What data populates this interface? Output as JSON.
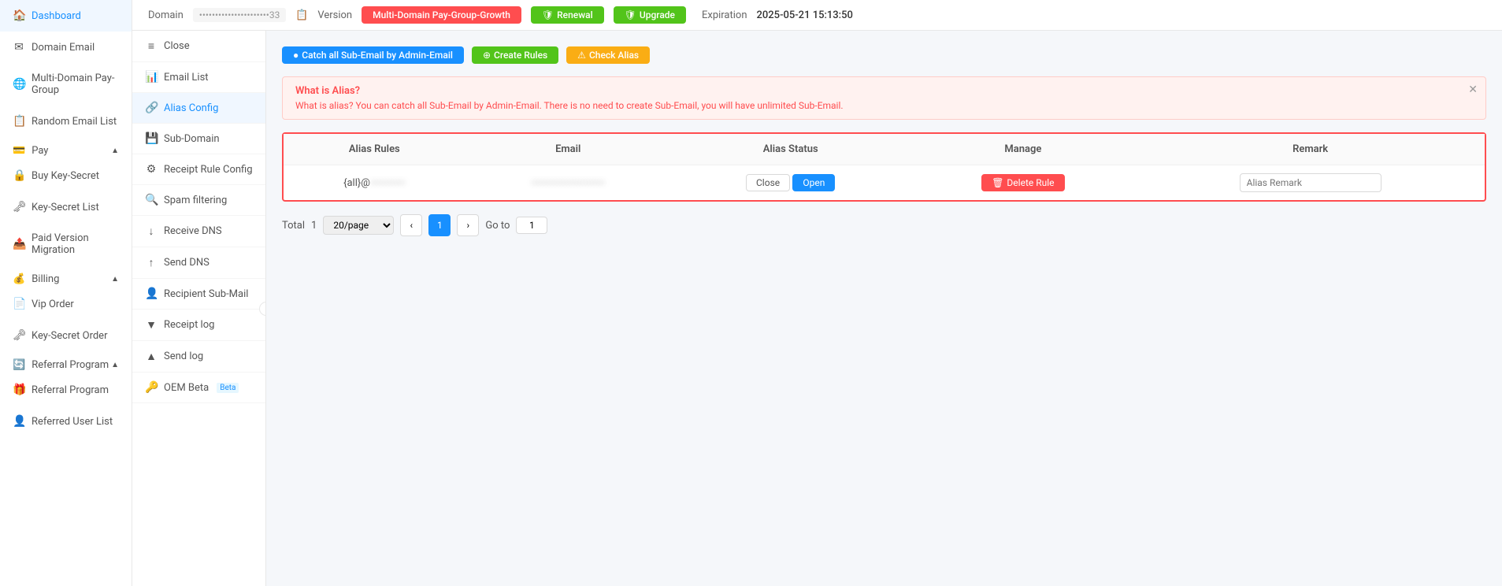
{
  "sidebar": {
    "items": [
      {
        "id": "dashboard",
        "label": "Dashboard",
        "icon": "🏠"
      },
      {
        "id": "domain-email",
        "label": "Domain Email",
        "icon": "✉"
      },
      {
        "id": "multi-domain",
        "label": "Multi-Domain Pay-Group",
        "icon": "🌐"
      },
      {
        "id": "random-email",
        "label": "Random Email List",
        "icon": "📋"
      },
      {
        "id": "pay",
        "label": "Pay",
        "icon": "💳",
        "expandable": true
      },
      {
        "id": "buy-key-secret",
        "label": "Buy Key-Secret",
        "icon": "🔒"
      },
      {
        "id": "key-secret-list",
        "label": "Key-Secret List",
        "icon": "🗝"
      },
      {
        "id": "paid-version",
        "label": "Paid Version Migration",
        "icon": "📤"
      },
      {
        "id": "billing",
        "label": "Billing",
        "icon": "💰",
        "expandable": true
      },
      {
        "id": "vip-order",
        "label": "Vip Order",
        "icon": "📄"
      },
      {
        "id": "key-secret-order",
        "label": "Key-Secret Order",
        "icon": "🗝"
      },
      {
        "id": "referral-program",
        "label": "Referral Program",
        "icon": "🔄",
        "expandable": true
      },
      {
        "id": "referral-program2",
        "label": "Referral Program",
        "icon": "🎁"
      },
      {
        "id": "referred-user",
        "label": "Referred User List",
        "icon": "👤"
      }
    ]
  },
  "header": {
    "domain_label": "Domain",
    "domain_value": "••••••••••••••••••••••33",
    "version_label": "Version",
    "version_value": "Multi-Domain Pay-Group-Growth",
    "renewal_label": "Renewal",
    "upgrade_label": "Upgrade",
    "expiration_label": "Expiration",
    "expiration_value": "2025-05-21 15:13:50"
  },
  "left_nav": {
    "close_label": "Close",
    "items": [
      {
        "id": "email-list",
        "label": "Email List",
        "icon": "📊"
      },
      {
        "id": "alias-config",
        "label": "Alias Config",
        "icon": "🔗",
        "active": true
      },
      {
        "id": "sub-domain",
        "label": "Sub-Domain",
        "icon": "💾"
      },
      {
        "id": "receipt-rule",
        "label": "Receipt Rule Config",
        "icon": "⚙"
      },
      {
        "id": "spam-filtering",
        "label": "Spam filtering",
        "icon": "🔍"
      },
      {
        "id": "receive-dns",
        "label": "Receive DNS",
        "icon": "↓"
      },
      {
        "id": "send-dns",
        "label": "Send DNS",
        "icon": "↑"
      },
      {
        "id": "recipient-sub",
        "label": "Recipient Sub-Mail",
        "icon": "👤"
      },
      {
        "id": "receipt-log",
        "label": "Receipt log",
        "icon": "▼"
      },
      {
        "id": "send-log",
        "label": "Send log",
        "icon": "▲"
      },
      {
        "id": "oem",
        "label": "OEM Beta",
        "icon": "🔑"
      }
    ]
  },
  "action_buttons": {
    "catch_all": "Catch all Sub-Email by Admin-Email",
    "create_rules": "Create Rules",
    "check_alias": "Check Alias"
  },
  "alert": {
    "title": "What is Alias?",
    "text": "What is alias? You can catch all Sub-Email by Admin-Email. There is no need to create Sub-Email, you will have unlimited Sub-Email."
  },
  "table": {
    "columns": [
      "Alias Rules",
      "Email",
      "Alias Status",
      "Manage",
      "Remark"
    ],
    "rows": [
      {
        "alias_rules": "{all}@••••••••••••••",
        "email": "••••••••••••••••••••",
        "close_btn": "Close",
        "open_btn": "Open",
        "delete_btn": "Delete Rule",
        "remark_placeholder": "Alias Remark"
      }
    ]
  },
  "pagination": {
    "total_label": "Total",
    "total": "1",
    "per_page": "20/page",
    "current_page": "1",
    "goto_label": "Go to",
    "goto_value": "1"
  }
}
